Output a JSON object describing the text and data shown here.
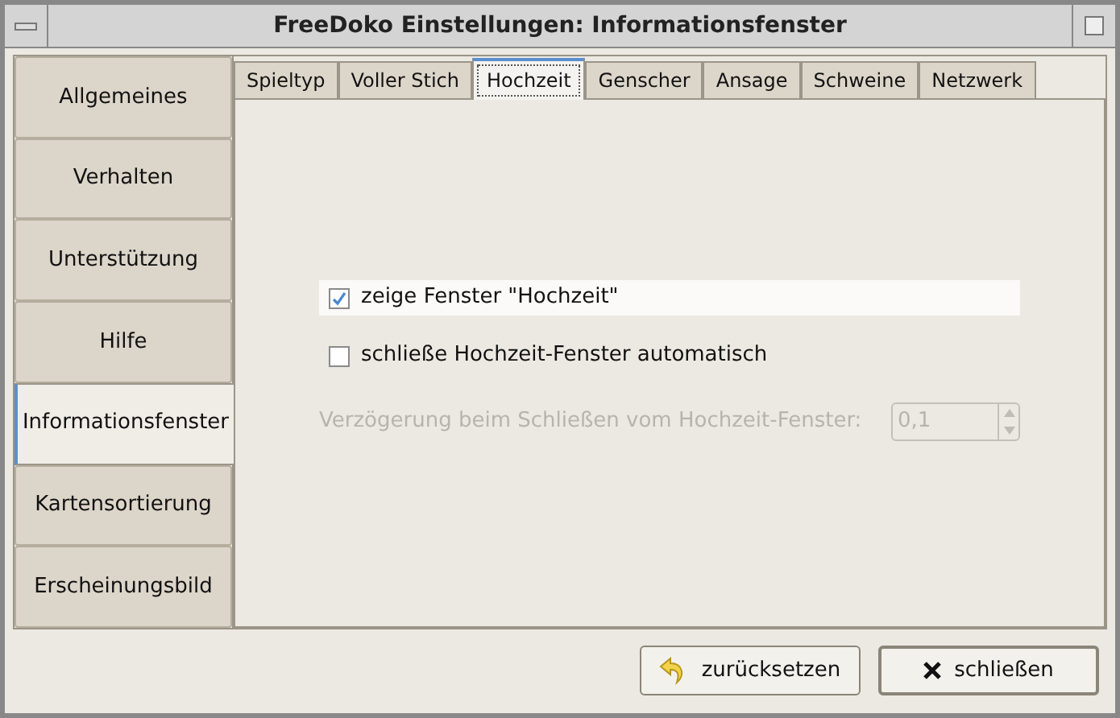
{
  "window": {
    "title": "FreeDoko Einstellungen: Informationsfenster"
  },
  "sidebar": {
    "items": [
      {
        "label": "Allgemeines",
        "selected": false
      },
      {
        "label": "Verhalten",
        "selected": false
      },
      {
        "label": "Unterstützung",
        "selected": false
      },
      {
        "label": "Hilfe",
        "selected": false
      },
      {
        "label": "Informationsfenster",
        "selected": true
      },
      {
        "label": "Kartensortierung",
        "selected": false
      },
      {
        "label": "Erscheinungsbild",
        "selected": false
      }
    ]
  },
  "tabs": [
    {
      "label": "Spieltyp",
      "selected": false
    },
    {
      "label": "Voller Stich",
      "selected": false
    },
    {
      "label": "Hochzeit",
      "selected": true
    },
    {
      "label": "Genscher",
      "selected": false
    },
    {
      "label": "Ansage",
      "selected": false
    },
    {
      "label": "Schweine",
      "selected": false
    },
    {
      "label": "Netzwerk",
      "selected": false
    }
  ],
  "options": [
    {
      "kind": "checkbox",
      "label": "zeige Fenster \"Hochzeit\"",
      "checked": true,
      "highlighted": true
    },
    {
      "kind": "checkbox",
      "label": "schließe Hochzeit-Fenster automatisch",
      "checked": false,
      "highlighted": false
    },
    {
      "kind": "spin",
      "label": "Verzögerung beim Schließen vom Hochzeit-Fenster:",
      "value": "0,1",
      "disabled": true
    }
  ],
  "buttons": [
    {
      "kind": "reset",
      "label": "zurücksetzen"
    },
    {
      "kind": "close",
      "label": "schließen"
    }
  ]
}
